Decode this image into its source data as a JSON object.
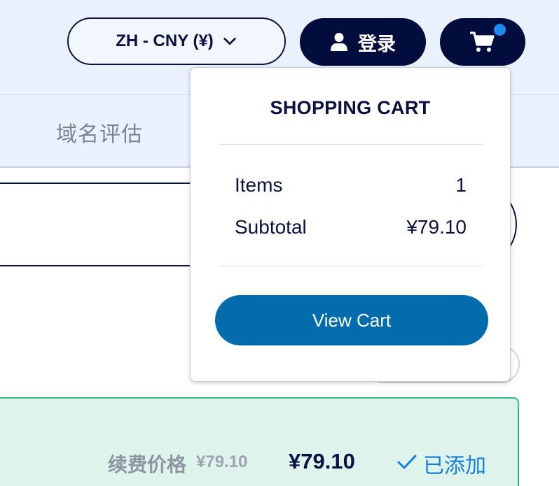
{
  "header": {
    "currency_label": "ZH - CNY (¥)",
    "login_label": "登录"
  },
  "subnav": {
    "item": "域名评估"
  },
  "result": {
    "renew_label": "续费价格",
    "renew_price": "¥79.10",
    "price": "¥79.10",
    "status": "已添加"
  },
  "cart": {
    "title": "SHOPPING CART",
    "items_label": "Items",
    "items_value": "1",
    "subtotal_label": "Subtotal",
    "subtotal_value": "¥79.10",
    "view_cart_label": "View Cart"
  },
  "colors": {
    "navy": "#020d3d",
    "accent_blue": "#036cac",
    "notification_dot": "#1a8bef",
    "success_green": "#2fbd7a"
  },
  "icons": [
    "chevron-down-icon",
    "user-icon",
    "cart-icon",
    "check-icon"
  ]
}
